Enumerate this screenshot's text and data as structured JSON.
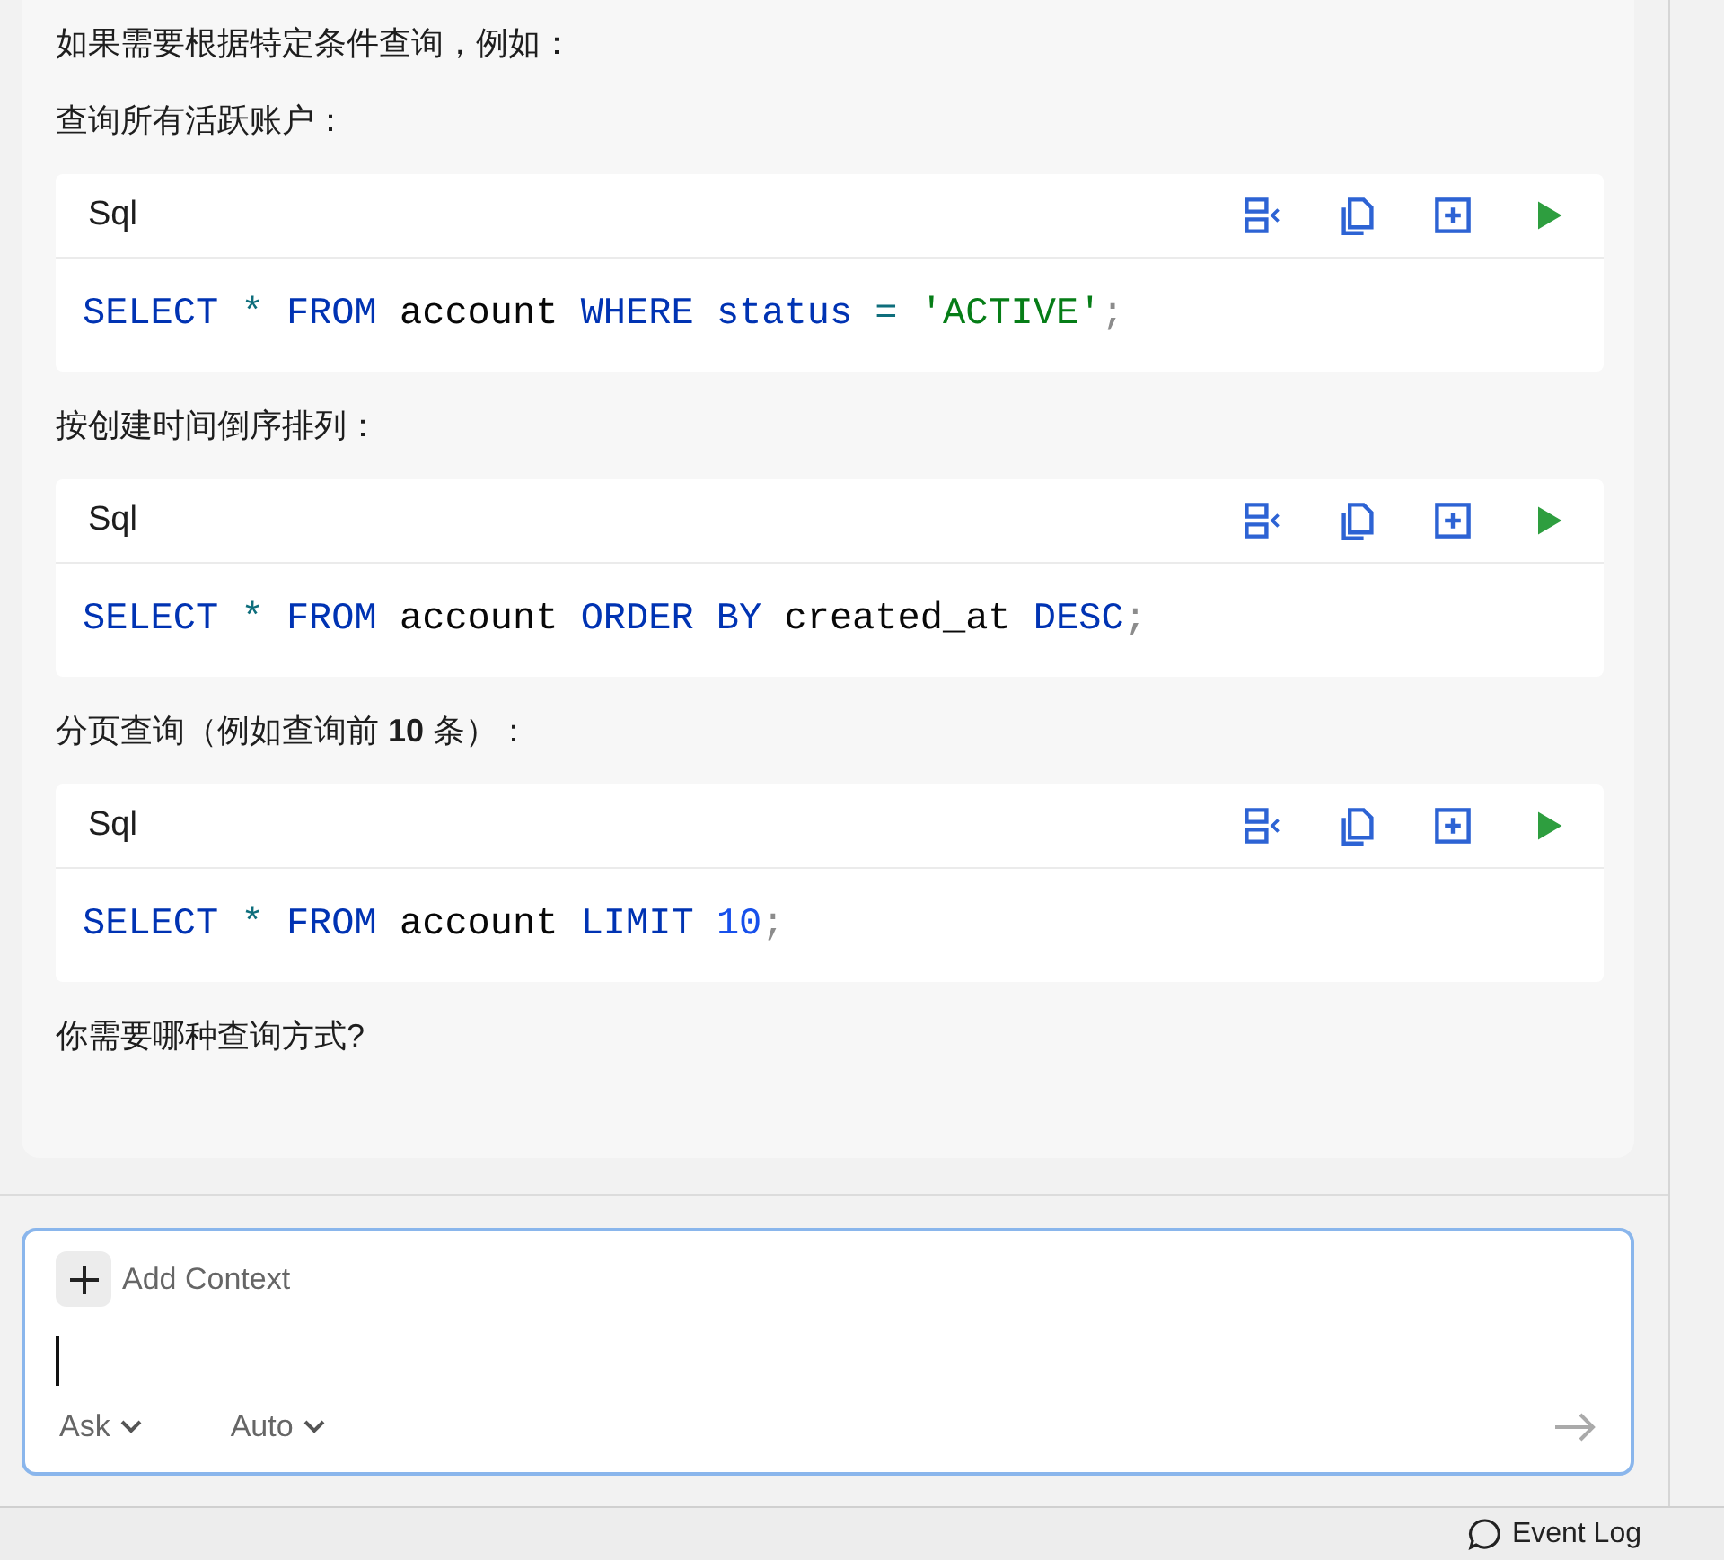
{
  "messages": [
    {
      "kind": "text",
      "text": "如果需要根据特定条件查询，例如："
    },
    {
      "kind": "text",
      "text": "查询所有活跃账户："
    },
    {
      "kind": "code",
      "language": "Sql",
      "tokens": [
        {
          "text": "SELECT",
          "kind": "keyword"
        },
        {
          "text": "*",
          "kind": "operator"
        },
        {
          "text": "FROM",
          "kind": "keyword"
        },
        {
          "text": "account",
          "kind": "plain"
        },
        {
          "text": "WHERE",
          "kind": "keyword"
        },
        {
          "text": "status",
          "kind": "keyword"
        },
        {
          "text": "=",
          "kind": "operator"
        },
        {
          "text": "'ACTIVE'",
          "kind": "string"
        },
        {
          "text": ";",
          "kind": "punct"
        }
      ]
    },
    {
      "kind": "text",
      "text": "按创建时间倒序排列："
    },
    {
      "kind": "code",
      "language": "Sql",
      "tokens": [
        {
          "text": "SELECT",
          "kind": "keyword"
        },
        {
          "text": "*",
          "kind": "operator"
        },
        {
          "text": "FROM",
          "kind": "keyword"
        },
        {
          "text": "account",
          "kind": "plain"
        },
        {
          "text": "ORDER BY",
          "kind": "keyword"
        },
        {
          "text": "created_at",
          "kind": "plain"
        },
        {
          "text": "DESC",
          "kind": "keyword"
        },
        {
          "text": ";",
          "kind": "punct"
        }
      ]
    },
    {
      "kind": "text",
      "text": "分页查询（例如查询前 **10** 条）："
    },
    {
      "kind": "code",
      "language": "Sql",
      "tokens": [
        {
          "text": "SELECT",
          "kind": "keyword"
        },
        {
          "text": "*",
          "kind": "operator"
        },
        {
          "text": "FROM",
          "kind": "keyword"
        },
        {
          "text": "account",
          "kind": "plain"
        },
        {
          "text": "LIMIT",
          "kind": "keyword"
        },
        {
          "text": "10",
          "kind": "number"
        },
        {
          "text": ";",
          "kind": "punct"
        }
      ]
    },
    {
      "kind": "text",
      "text": "你需要哪种查询方式?"
    }
  ],
  "composer": {
    "add_context": "Add Context",
    "mode": "Ask",
    "model": "Auto"
  },
  "status_bar": {
    "event_log": "Event Log"
  }
}
